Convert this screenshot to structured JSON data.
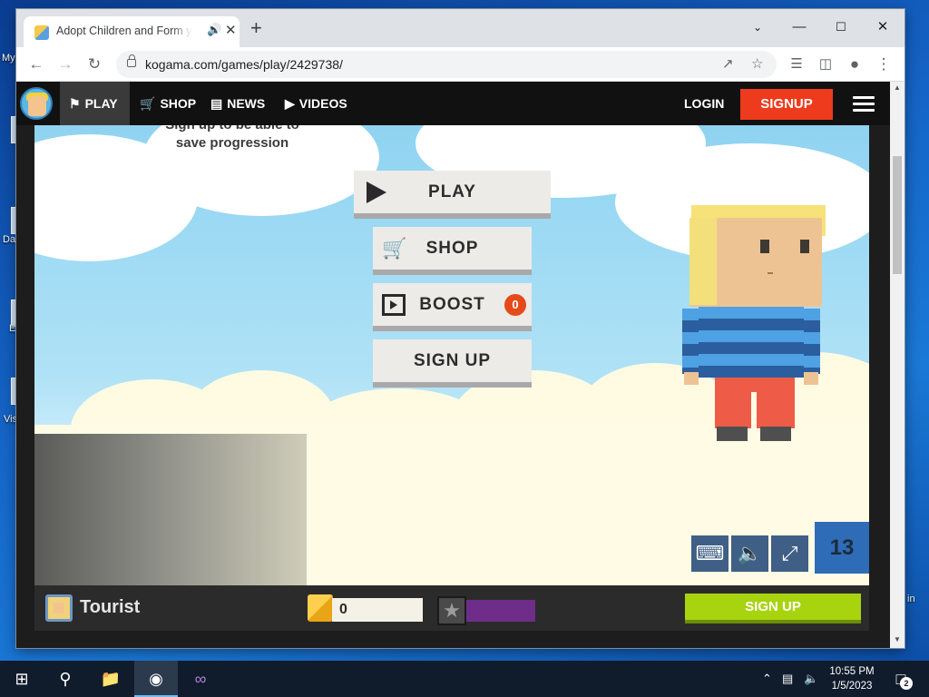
{
  "desktop": {
    "fragments": [
      "My",
      "Da",
      "E",
      "Vis",
      "in"
    ]
  },
  "browser": {
    "tab_title": "Adopt Children and Form your Family",
    "url": "kogama.com/games/play/2429738/"
  },
  "site_nav": {
    "play_label": "PLAY",
    "shop_label": "SHOP",
    "news_label": "NEWS",
    "videos_label": "VIDEOS",
    "login_label": "LOGIN",
    "signup_label": "SIGNUP"
  },
  "game": {
    "hint_text": "Sign up to be able to save progression",
    "menu": {
      "play_label": "PLAY",
      "shop_label": "SHOP",
      "boost_label": "BOOST",
      "boost_badge": "0",
      "signup_label": "SIGN UP"
    },
    "level": "13"
  },
  "player_bar": {
    "username": "Tourist",
    "gold": "0",
    "signup_label": "SIGN UP"
  },
  "taskbar": {
    "time": "10:55 PM",
    "date": "1/5/2023",
    "notification_count": "2"
  },
  "colors": {
    "signup_red": "#ee3b1e",
    "signup_green": "#a8d40f",
    "xp_purple": "#6f2d8a",
    "level_blue": "#2f6cb8"
  }
}
